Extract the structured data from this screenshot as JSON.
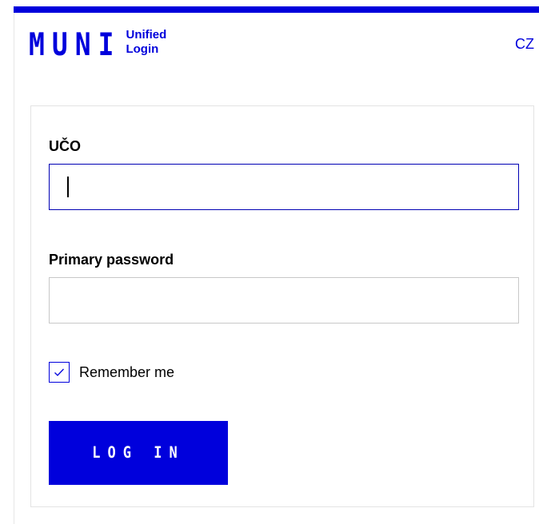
{
  "header": {
    "logo": {
      "mark": "MUNI",
      "line1": "Unified",
      "line2": "Login"
    },
    "language_link": "CZ"
  },
  "form": {
    "uco_label": "UČO",
    "uco_value": "",
    "password_label": "Primary password",
    "password_value": "",
    "remember_label": "Remember me",
    "remember_checked": true,
    "submit_label": "LOG IN"
  },
  "colors": {
    "brand_blue": "#0000dc",
    "border_gray": "#c8c8c8",
    "card_border": "#e3e3e3"
  },
  "icons": {
    "checkbox": "check-icon"
  }
}
